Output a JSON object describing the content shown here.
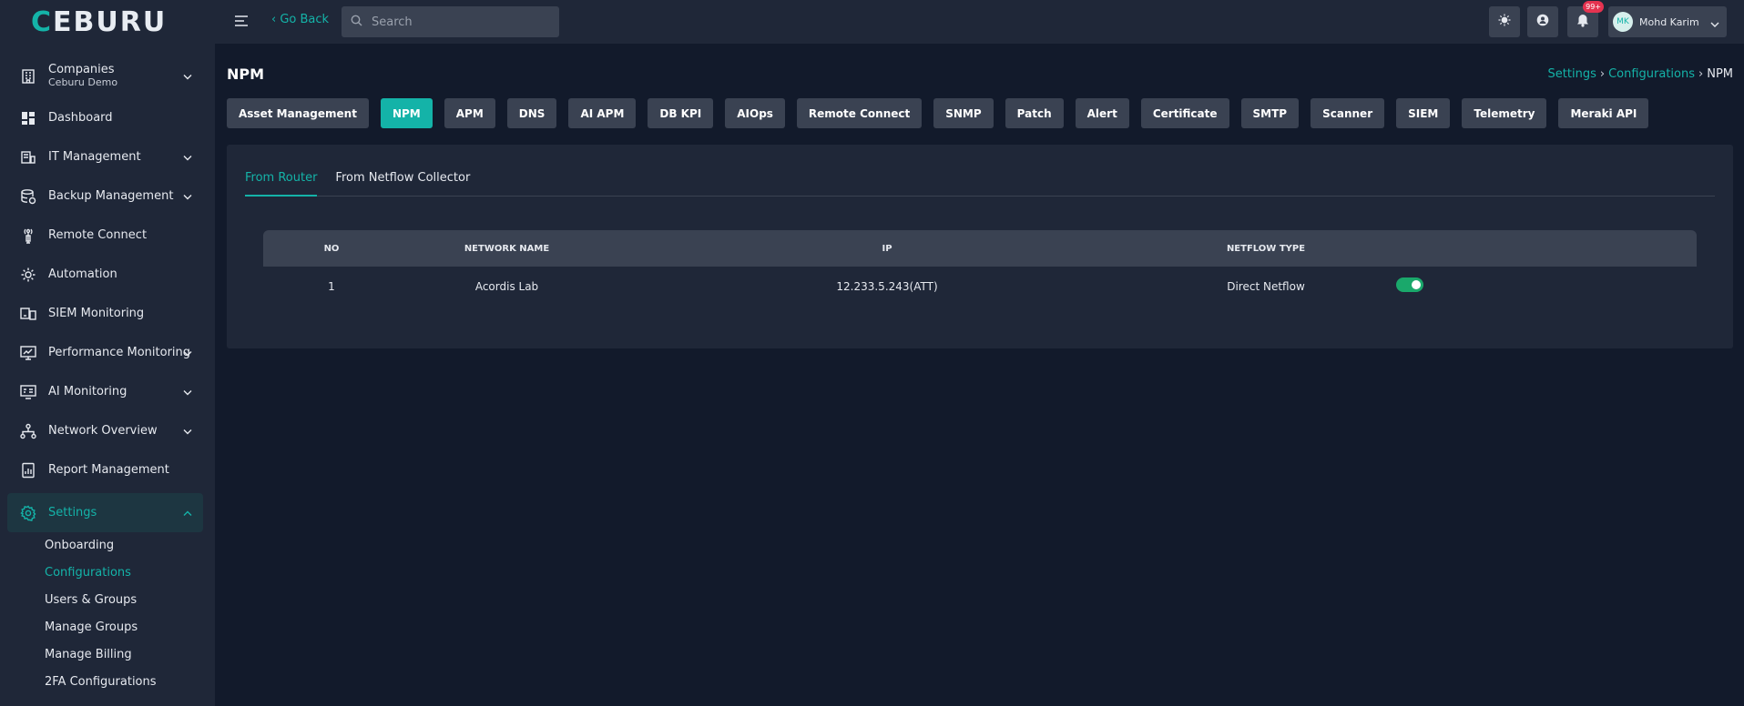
{
  "brand": {
    "logo_first": "C",
    "logo_rest": "EBURU"
  },
  "topbar": {
    "go_back": "‹ Go Back",
    "search_placeholder": "Search",
    "notification_count": "99+",
    "user_initials": "MK",
    "user_name": "Mohd Karim"
  },
  "sidebar": {
    "companies": {
      "label": "Companies",
      "sub": "Ceburu Demo"
    },
    "items": [
      {
        "label": "Dashboard",
        "icon": "dashboard-icon"
      },
      {
        "label": "IT Management",
        "icon": "it-management-icon"
      },
      {
        "label": "Backup Management",
        "icon": "database-icon"
      },
      {
        "label": "Remote Connect",
        "icon": "antenna-icon"
      },
      {
        "label": "Automation",
        "icon": "gear-settings-icon"
      },
      {
        "label": "SIEM Monitoring",
        "icon": "devices-icon"
      },
      {
        "label": "Performance Monitoring",
        "icon": "monitor-chart-icon"
      },
      {
        "label": "AI Monitoring",
        "icon": "ai-monitor-icon"
      },
      {
        "label": "Network Overview",
        "icon": "network-icon"
      },
      {
        "label": "Report Management",
        "icon": "report-icon"
      },
      {
        "label": "Settings",
        "icon": "settings-icon"
      }
    ],
    "settings_sub": [
      "Onboarding",
      "Configurations",
      "Users & Groups",
      "Manage Groups",
      "Manage Billing",
      "2FA Configurations"
    ]
  },
  "page": {
    "title": "NPM",
    "breadcrumb": [
      "Settings",
      "Configurations",
      "NPM"
    ]
  },
  "tabs": [
    "Asset Management",
    "NPM",
    "APM",
    "DNS",
    "AI APM",
    "DB KPI",
    "AIOps",
    "Remote Connect",
    "SNMP",
    "Patch",
    "Alert",
    "Certificate",
    "SMTP",
    "Scanner",
    "SIEM",
    "Telemetry",
    "Meraki API"
  ],
  "active_tab": "NPM",
  "subtabs": [
    "From Router",
    "From Netflow Collector"
  ],
  "table": {
    "headers": [
      "NO",
      "NETWORK NAME",
      "IP",
      "NETFLOW TYPE"
    ],
    "rows": [
      {
        "no": "1",
        "network_name": "Acordis Lab",
        "ip": "12.233.5.243(ATT)",
        "netflow_type": "Direct Netflow",
        "enabled": true
      }
    ]
  },
  "colors": {
    "accent": "#14b3a8",
    "toggle_on": "#1aa86b",
    "badge": "#e53350"
  }
}
